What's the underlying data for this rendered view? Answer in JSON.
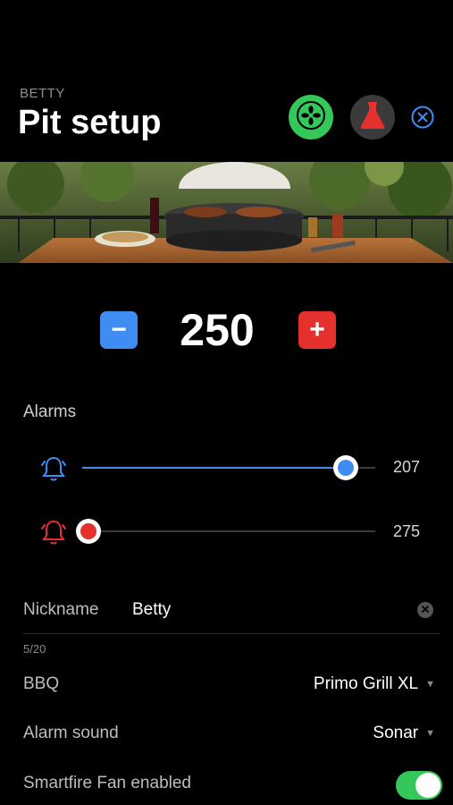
{
  "header": {
    "kicker": "BETTY",
    "title": "Pit setup"
  },
  "icons": {
    "fan": "fan-icon",
    "lab": "flask-icon",
    "close": "close-circle-icon",
    "alarm_low": "bell-icon-blue",
    "alarm_high": "bell-icon-red",
    "clear": "clear-x-icon"
  },
  "temperature": {
    "target": "250",
    "minus_label": "−",
    "plus_label": "+"
  },
  "alarms": {
    "title": "Alarms",
    "low": {
      "value": "207",
      "color": "#3f8cf2",
      "level": 0.9
    },
    "high": {
      "value": "275",
      "color": "#e5312d",
      "level": 0.0
    }
  },
  "form": {
    "nickname_label": "Nickname",
    "nickname_value": "Betty",
    "nickname_counter": "5/20",
    "bbq_label": "BBQ",
    "bbq_value": "Primo Grill XL",
    "alarm_sound_label": "Alarm sound",
    "alarm_sound_value": "Sonar",
    "smartfire_label": "Smartfire Fan enabled",
    "smartfire_enabled": true
  },
  "colors": {
    "green": "#34c759",
    "blue": "#3f8cf2",
    "red": "#e5312d"
  }
}
